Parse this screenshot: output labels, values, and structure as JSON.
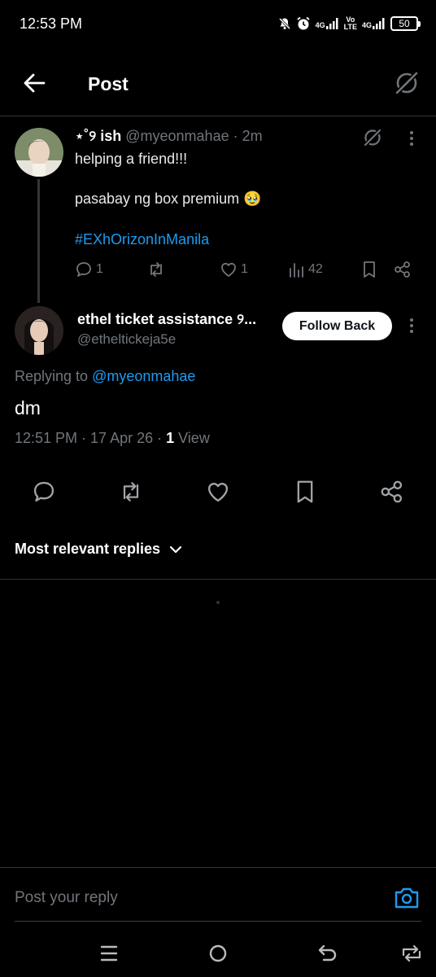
{
  "status_bar": {
    "time": "12:53 PM",
    "net1": "4G",
    "net2_top": "Vo",
    "net2_bottom": "LTE",
    "net3": "4G",
    "battery": "50",
    "icons": [
      "mute-bell-icon",
      "alarm-icon",
      "signal-icon",
      "signal-icon",
      "battery-icon"
    ]
  },
  "header": {
    "title": "Post",
    "back_icon": "arrow-left-icon",
    "grok_icon": "grok-icon"
  },
  "original_post": {
    "name": "⋆˚୨ ish",
    "handle": "@myeonmahae",
    "separator": "·",
    "time": "2m",
    "line1": "helping a friend!!!",
    "line2": "pasabay ng box premium 🥹",
    "hashtag": "#EXhOrizonInManila",
    "replies": "1",
    "likes": "1",
    "views": "42"
  },
  "reply": {
    "name": "ethel ticket assistance ୨...",
    "handle": "@etheltickeja5e",
    "follow_label": "Follow Back",
    "replying_prefix": "Replying to ",
    "replying_mention": "@myeonmahae",
    "body": "dm",
    "timestamp": "12:51 PM · 17 Apr 26 · ",
    "view_count": "1",
    "view_label": " View"
  },
  "sort": {
    "label": "Most relevant replies"
  },
  "composer": {
    "placeholder": "Post your reply"
  },
  "colors": {
    "background": "#000000",
    "accent": "#1d9bf0",
    "secondary_text": "#71767b",
    "divider": "#2f3336"
  }
}
